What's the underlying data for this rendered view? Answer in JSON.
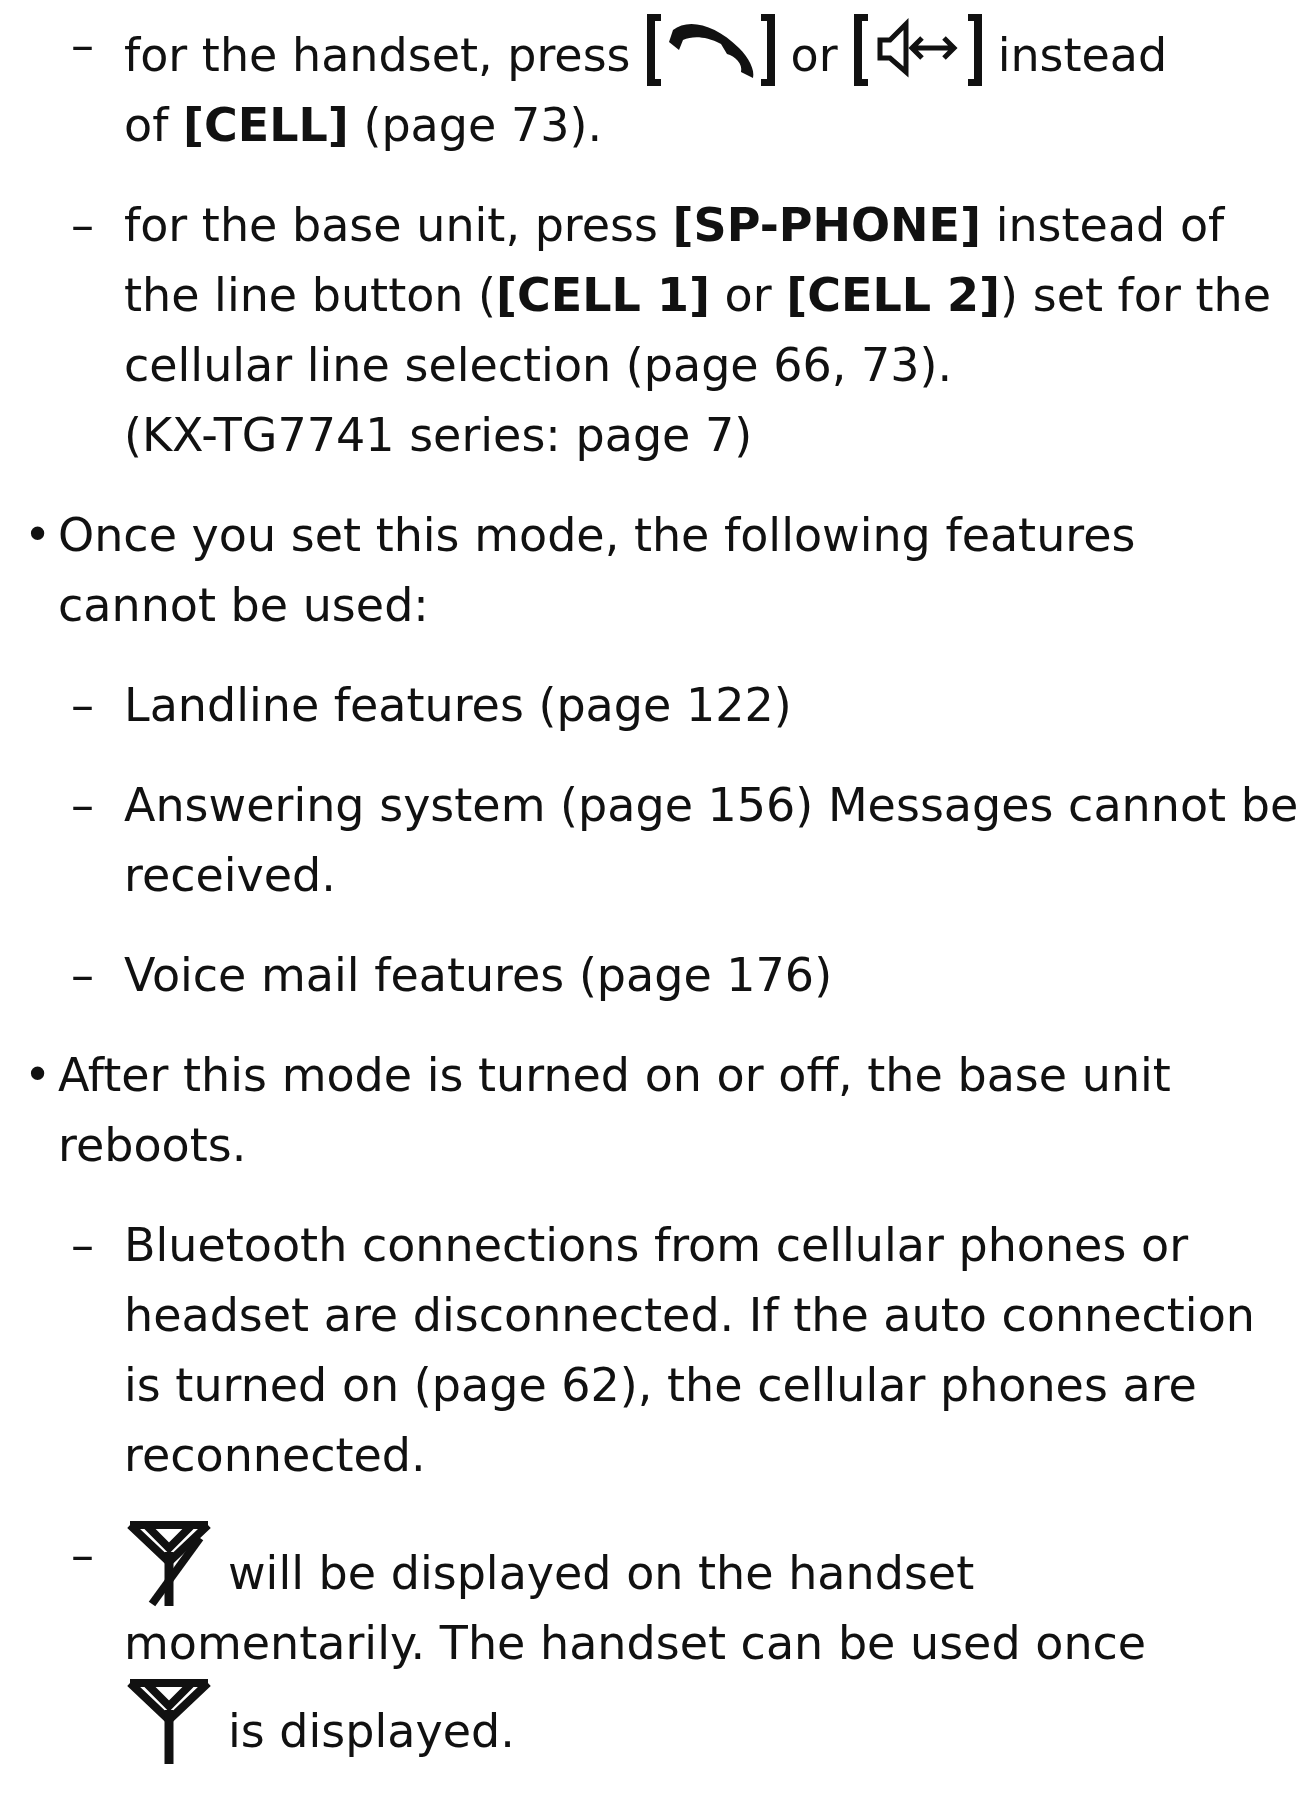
{
  "items": [
    {
      "kind": "dash-keys",
      "marker": "–",
      "lines": [
        "for the handset, press",
        "or",
        "instead",
        "of **[CELL]** (page 73)."
      ]
    },
    {
      "kind": "dash",
      "marker": "–",
      "lines": [
        "for the base unit, press **[SP-PHONE]** instead of the line button (**[CELL 1]** or **[CELL 2]**) set for the cellular line selection (page 66, 73).",
        "(KX-TG7741 series: page 7)"
      ]
    },
    {
      "kind": "bullet",
      "marker": "•",
      "lines": [
        "Once you set this mode, the following features cannot be used:"
      ]
    },
    {
      "kind": "dash",
      "marker": "–",
      "lines": [
        "Landline features (page 122)"
      ]
    },
    {
      "kind": "dash",
      "marker": "–",
      "lines": [
        "Answering system (page 156) Messages cannot be received."
      ]
    },
    {
      "kind": "dash",
      "marker": "–",
      "lines": [
        "Voice mail features (page 176)"
      ]
    },
    {
      "kind": "bullet",
      "marker": "•",
      "lines": [
        "After this mode is turned on or off, the base unit reboots."
      ]
    },
    {
      "kind": "dash",
      "marker": "–",
      "lines": [
        "Bluetooth connections from cellular phones or headset are disconnected. If the auto connection is turned on (page 62), the cellular phones are reconnected."
      ]
    },
    {
      "kind": "dash-antenna",
      "marker": "–",
      "lines": [
        "will be displayed on the handset",
        "momentarily. The handset can be used once",
        "is displayed."
      ]
    }
  ]
}
